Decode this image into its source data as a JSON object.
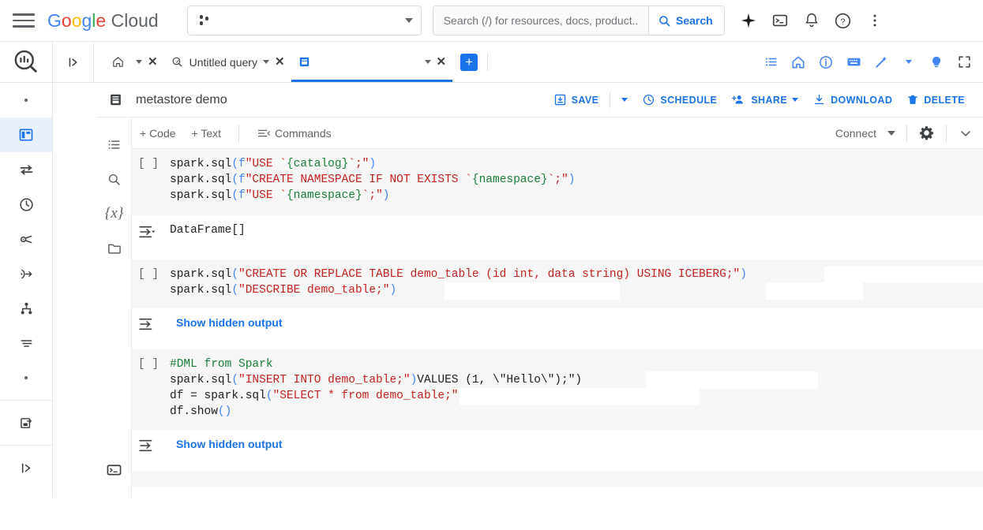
{
  "topbar": {
    "menu_icon": "hamburger-icon",
    "logo": {
      "g1": "G",
      "o1": "o",
      "o2": "o",
      "g2": "g",
      "l": "l",
      "e": "e",
      "cloud": "Cloud"
    },
    "project_selector": {
      "value": "",
      "icon": "project-dots-icon"
    },
    "search": {
      "placeholder": "Search (/) for resources, docs, product..",
      "value": "",
      "button_label": "Search",
      "icon": "search-icon"
    },
    "icons": [
      "gemini-sparkle-icon",
      "cloud-shell-icon",
      "notifications-bell-icon",
      "help-question-icon",
      "more-vert-icon"
    ]
  },
  "left_rail": {
    "logo_icon": "bigquery-logo-icon",
    "items": [
      {
        "icon": "dot-icon",
        "active": false
      },
      {
        "icon": "studio-panel-icon",
        "active": true
      },
      {
        "icon": "transfer-icon",
        "active": false
      },
      {
        "icon": "scheduled-queries-clock-icon",
        "active": false
      },
      {
        "icon": "analytics-hub-icon",
        "active": false
      },
      {
        "icon": "pipelines-icon",
        "active": false
      },
      {
        "icon": "dataform-hierarchy-icon",
        "active": false
      },
      {
        "icon": "data-prep-icon",
        "active": false
      },
      {
        "icon": "dot-icon",
        "active": false
      },
      {
        "icon": "migration-icon",
        "active": false
      },
      {
        "icon": "expand-panel-icon",
        "active": false
      }
    ]
  },
  "tabbar": {
    "expand_icon": "expand-panel-icon",
    "tabs": [
      {
        "icon": "home-icon",
        "label": "",
        "has_caret": true,
        "has_close": true,
        "active": false
      },
      {
        "icon": "query-icon",
        "label": "Untitled query",
        "has_caret": true,
        "has_close": true,
        "active": false
      },
      {
        "icon": "notebook-icon",
        "label": "",
        "has_caret": true,
        "has_close": true,
        "active": true
      }
    ],
    "add_tab_label": "+",
    "right_icons": [
      "list-view-icon",
      "home-icon",
      "info-icon",
      "keyboard-icon",
      "magic-wand-icon",
      "lightbulb-icon",
      "fullscreen-icon"
    ]
  },
  "notebook": {
    "icon": "notebook-icon",
    "title": "metastore demo",
    "actions": [
      {
        "label": "SAVE",
        "icon": "save-icon",
        "caret": true
      },
      {
        "label": "SCHEDULE",
        "icon": "clock-icon",
        "caret": false
      },
      {
        "label": "SHARE",
        "icon": "share-person-icon",
        "caret": true
      },
      {
        "label": "DOWNLOAD",
        "icon": "download-icon",
        "caret": false
      },
      {
        "label": "DELETE",
        "icon": "trash-icon",
        "caret": false
      }
    ],
    "toolbar": {
      "add_code": "+ Code",
      "add_text": "+ Text",
      "commands": "Commands",
      "commands_icon": "commands-icon",
      "connect": "Connect",
      "settings_icon": "gear-icon",
      "collapse_icon": "chevron-down-icon"
    },
    "side_rail": [
      "toc-list-icon",
      "search-icon",
      "variables-icon",
      "folder-icon",
      "terminal-icon"
    ],
    "cells": [
      {
        "prompt": "[ ]",
        "lines": [
          [
            {
              "t": "spark.sql",
              "c": "plain"
            },
            {
              "t": "(",
              "c": "paren"
            },
            {
              "t": "f",
              "c": "f"
            },
            {
              "t": "\"USE `",
              "c": "str"
            },
            {
              "t": "{catalog}",
              "c": "var"
            },
            {
              "t": "`;\"",
              "c": "str"
            },
            {
              "t": ")",
              "c": "paren"
            }
          ],
          [
            {
              "t": "spark.sql",
              "c": "plain"
            },
            {
              "t": "(",
              "c": "paren"
            },
            {
              "t": "f",
              "c": "f"
            },
            {
              "t": "\"CREATE NAMESPACE IF NOT EXISTS `",
              "c": "str"
            },
            {
              "t": "{namespace}",
              "c": "var"
            },
            {
              "t": "`;\"",
              "c": "str"
            },
            {
              "t": ")",
              "c": "paren"
            }
          ],
          [
            {
              "t": "spark.sql",
              "c": "plain"
            },
            {
              "t": "(",
              "c": "paren"
            },
            {
              "t": "f",
              "c": "f"
            },
            {
              "t": "\"USE `",
              "c": "str"
            },
            {
              "t": "{namespace}",
              "c": "var"
            },
            {
              "t": "`;\"",
              "c": "str"
            },
            {
              "t": ")",
              "c": "paren"
            }
          ]
        ],
        "output": {
          "type": "text",
          "icon": "output-arrow-icon",
          "text": "DataFrame[]"
        }
      },
      {
        "prompt": "[ ]",
        "lines": [
          [
            {
              "t": "spark.sql",
              "c": "plain"
            },
            {
              "t": "(",
              "c": "paren"
            },
            {
              "t": "\"CREATE OR REPLACE TABLE demo_table (id int, data string) USING ICEBERG;\"",
              "c": "str"
            },
            {
              "t": ")",
              "c": "paren"
            }
          ],
          [
            {
              "t": "spark.sql",
              "c": "plain"
            },
            {
              "t": "(",
              "c": "paren"
            },
            {
              "t": "\"DESCRIBE demo_table;\"",
              "c": "str"
            },
            {
              "t": ")",
              "c": "paren"
            }
          ]
        ],
        "output": {
          "type": "link",
          "icon": "output-arrow-icon",
          "text": "Show hidden output"
        }
      },
      {
        "prompt": "[ ]",
        "lines": [
          [
            {
              "t": "#DML from Spark",
              "c": "com"
            }
          ],
          [
            {
              "t": "spark.sql",
              "c": "plain"
            },
            {
              "t": "(",
              "c": "paren"
            },
            {
              "t": "\"INSERT INTO demo_table;\"",
              "c": "str"
            },
            {
              "t": ")",
              "c": "paren"
            },
            {
              "t": "VALUES (1, \\\"Hello\\\");\")",
              "c": "plain"
            }
          ],
          [
            {
              "t": "df = spark.sql",
              "c": "plain"
            },
            {
              "t": "(",
              "c": "paren"
            },
            {
              "t": "\"SELECT * from demo_table;\"",
              "c": "str"
            },
            {
              "t": ")",
              "c": "paren"
            }
          ],
          [
            {
              "t": "df.show",
              "c": "plain"
            },
            {
              "t": "()",
              "c": "paren"
            }
          ]
        ],
        "output": {
          "type": "link",
          "icon": "output-arrow-icon",
          "text": "Show hidden output"
        }
      }
    ]
  },
  "colors": {
    "accent_blue": "#1a73e8",
    "cell_bg": "#f6f6f6",
    "string_red": "#c5221f",
    "var_green": "#188038",
    "paren_blue": "#4285f4",
    "rail_active_bg": "#e8f0fe"
  }
}
